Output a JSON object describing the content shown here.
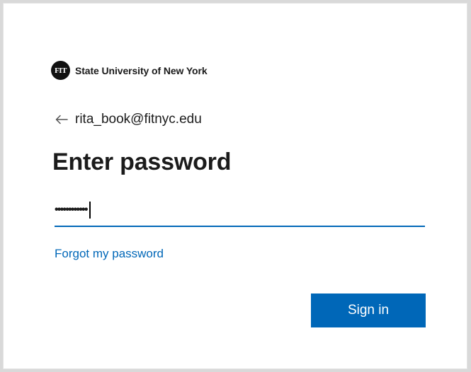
{
  "brand": {
    "logo_text": "FIT",
    "name": "State University of New York"
  },
  "identity": {
    "email": "rita_book@fitnyc.edu",
    "back_icon": "arrow-left-icon"
  },
  "title": "Enter password",
  "password_field": {
    "masked_value": "••••••••••••"
  },
  "links": {
    "forgot_password": "Forgot my password"
  },
  "buttons": {
    "sign_in": "Sign in"
  },
  "colors": {
    "accent": "#0067b8",
    "text": "#1b1b1b",
    "background": "#ffffff"
  }
}
